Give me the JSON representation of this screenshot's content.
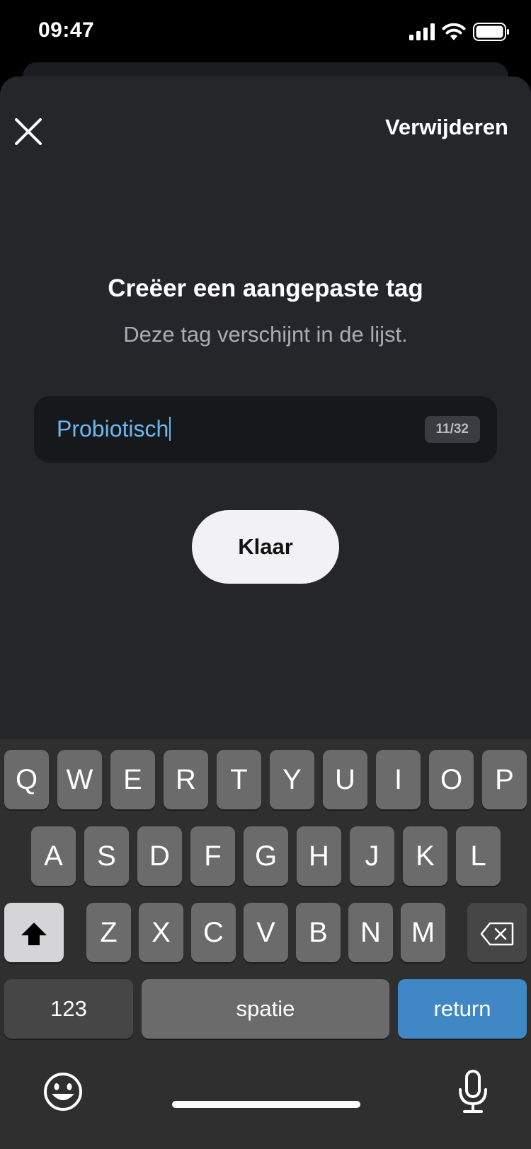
{
  "status_bar": {
    "time": "09:47"
  },
  "header": {
    "delete_label": "Verwijderen"
  },
  "dialog": {
    "title": "Creëer een aangepaste tag",
    "subtitle": "Deze tag verschijnt in de lijst.",
    "input_value": "Probiotisch",
    "counter": "11/32",
    "done_label": "Klaar"
  },
  "keyboard": {
    "row1": [
      "Q",
      "W",
      "E",
      "R",
      "T",
      "Y",
      "U",
      "I",
      "O",
      "P"
    ],
    "row2": [
      "A",
      "S",
      "D",
      "F",
      "G",
      "H",
      "J",
      "K",
      "L"
    ],
    "row3": [
      "Z",
      "X",
      "C",
      "V",
      "B",
      "N",
      "M"
    ],
    "numbers_label": "123",
    "space_label": "spatie",
    "return_label": "return"
  },
  "colors": {
    "sheet_bg": "#25262a",
    "input_text": "#6bb8ef",
    "return_key": "#3f88c5"
  },
  "icons": [
    "close-icon",
    "shift-icon",
    "backspace-icon",
    "emoji-icon",
    "microphone-icon",
    "signal-icon",
    "wifi-icon",
    "battery-icon"
  ]
}
